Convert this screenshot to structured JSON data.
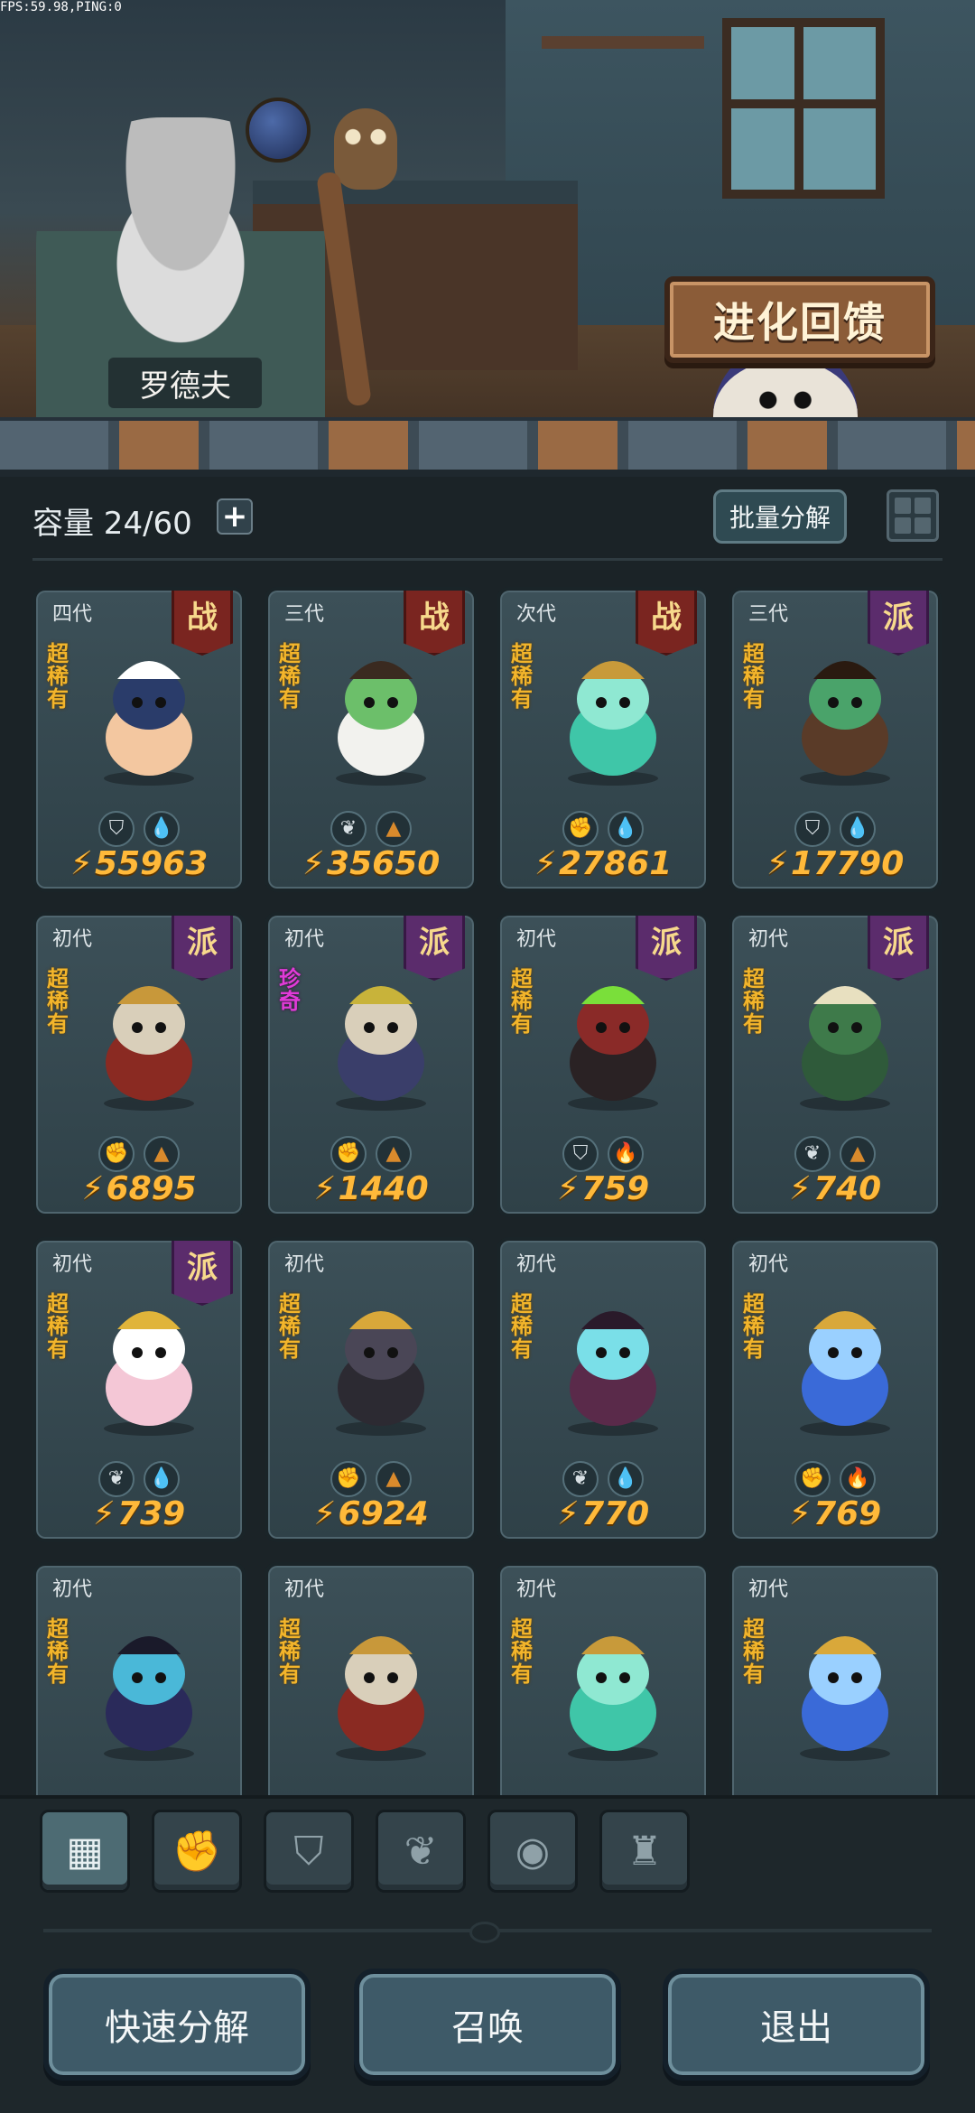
{
  "debug": {
    "fps_text": "FPS:59.98,PING:0"
  },
  "scene": {
    "npc_name": "罗德夫",
    "evolve_button": "进化回馈"
  },
  "capacity": {
    "label": "容量 24/60",
    "plus": "+"
  },
  "toolbar": {
    "batch_decompose": "批量分解"
  },
  "cards": [
    {
      "gen": "四代",
      "badge": "战",
      "badge_type": "war",
      "rarity": "超稀有",
      "rarity_type": "super",
      "icons": [
        "shield",
        "water"
      ],
      "power": "55963",
      "sprite": "fox-girl"
    },
    {
      "gen": "三代",
      "badge": "战",
      "badge_type": "war",
      "rarity": "超稀有",
      "rarity_type": "super",
      "icons": [
        "leaf",
        "earth"
      ],
      "power": "35650",
      "sprite": "white-owl"
    },
    {
      "gen": "次代",
      "badge": "战",
      "badge_type": "war",
      "rarity": "超稀有",
      "rarity_type": "super",
      "icons": [
        "fist",
        "water"
      ],
      "power": "27861",
      "sprite": "water-spirit"
    },
    {
      "gen": "三代",
      "badge": "派",
      "badge_type": "sect",
      "rarity": "超稀有",
      "rarity_type": "super",
      "icons": [
        "shield",
        "water"
      ],
      "power": "17790",
      "sprite": "tree-ent"
    },
    {
      "gen": "初代",
      "badge": "派",
      "badge_type": "sect",
      "rarity": "超稀有",
      "rarity_type": "super",
      "icons": [
        "fist",
        "earth"
      ],
      "power": "6895",
      "sprite": "mushroom-red"
    },
    {
      "gen": "初代",
      "badge": "派",
      "badge_type": "sect",
      "rarity": "珍奇",
      "rarity_type": "rare",
      "icons": [
        "fist",
        "earth"
      ],
      "power": "1440",
      "sprite": "mushroom-wizard"
    },
    {
      "gen": "初代",
      "badge": "派",
      "badge_type": "sect",
      "rarity": "超稀有",
      "rarity_type": "super",
      "icons": [
        "shield",
        "fire"
      ],
      "power": "759",
      "sprite": "dark-boar"
    },
    {
      "gen": "初代",
      "badge": "派",
      "badge_type": "sect",
      "rarity": "超稀有",
      "rarity_type": "super",
      "icons": [
        "leaf",
        "earth"
      ],
      "power": "740",
      "sprite": "moss-golem"
    },
    {
      "gen": "初代",
      "badge": "派",
      "badge_type": "sect",
      "rarity": "超稀有",
      "rarity_type": "super",
      "icons": [
        "leaf",
        "water"
      ],
      "power": "739",
      "sprite": "pink-queen"
    },
    {
      "gen": "初代",
      "badge": "",
      "badge_type": "none",
      "rarity": "超稀有",
      "rarity_type": "super",
      "icons": [
        "fist",
        "earth"
      ],
      "power": "6924",
      "sprite": "black-wolf"
    },
    {
      "gen": "初代",
      "badge": "",
      "badge_type": "none",
      "rarity": "超稀有",
      "rarity_type": "super",
      "icons": [
        "leaf",
        "water"
      ],
      "power": "770",
      "sprite": "dark-sorceress"
    },
    {
      "gen": "初代",
      "badge": "",
      "badge_type": "none",
      "rarity": "超稀有",
      "rarity_type": "super",
      "icons": [
        "fist",
        "fire"
      ],
      "power": "769",
      "sprite": "blue-flame"
    },
    {
      "gen": "初代",
      "badge": "",
      "badge_type": "none",
      "rarity": "超稀有",
      "rarity_type": "super",
      "icons": [],
      "power": "",
      "sprite": "dark-fairy"
    },
    {
      "gen": "初代",
      "badge": "",
      "badge_type": "none",
      "rarity": "超稀有",
      "rarity_type": "super",
      "icons": [],
      "power": "",
      "sprite": "mushroom-red"
    },
    {
      "gen": "初代",
      "badge": "",
      "badge_type": "none",
      "rarity": "超稀有",
      "rarity_type": "super",
      "icons": [],
      "power": "",
      "sprite": "water-spirit"
    },
    {
      "gen": "初代",
      "badge": "",
      "badge_type": "none",
      "rarity": "超稀有",
      "rarity_type": "super",
      "icons": [],
      "power": "",
      "sprite": "blue-flame"
    }
  ],
  "filters": [
    {
      "name": "all",
      "icon": "blocks-icon",
      "active": true
    },
    {
      "name": "fist",
      "icon": "fist-icon",
      "active": false
    },
    {
      "name": "shield",
      "icon": "shield-icon",
      "active": false
    },
    {
      "name": "leaf",
      "icon": "leaf-icon",
      "active": false
    },
    {
      "name": "orb",
      "icon": "orb-icon",
      "active": false
    },
    {
      "name": "tower",
      "icon": "tower-icon",
      "active": false
    }
  ],
  "actions": {
    "quick_decompose": "快速分解",
    "summon": "召唤",
    "exit": "退出"
  },
  "colors": {
    "power_text": "#ffb93a",
    "super_rare": "#f3b52b",
    "rare": "#e13bd8",
    "war_badge": "#7a2520",
    "sect_badge": "#5b2c6c"
  }
}
